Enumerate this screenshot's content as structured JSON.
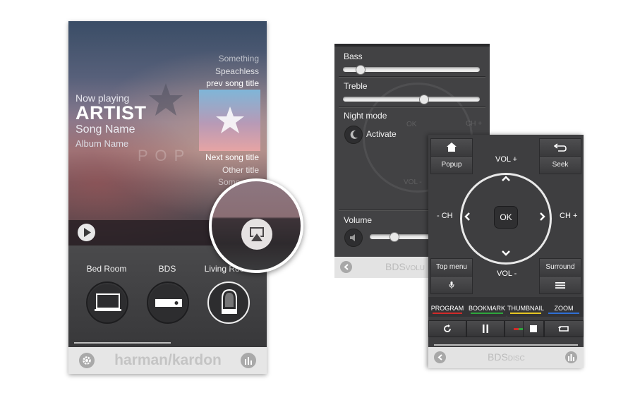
{
  "phone1": {
    "now_playing": "Now playing",
    "artist": "ARTIST",
    "song": "Song Name",
    "album": "Album Name",
    "watermark": "P O P",
    "prev_songs": [
      "Something",
      "Speachless",
      "prev song title"
    ],
    "next_songs": [
      "Next song title",
      "Other title",
      "Some"
    ],
    "rooms": [
      "Bed Room",
      "BDS",
      "Living Room"
    ],
    "brand": "harman/kardon"
  },
  "phone2": {
    "bass_label": "Bass",
    "bass_level": 0.1,
    "treble_label": "Treble",
    "treble_level": 0.6,
    "night_mode_label": "Night mode",
    "activate_label": "Activate",
    "volume_label": "Volume",
    "volume_level": 0.2,
    "footer_title": "BDS",
    "footer_sub": "VOLU",
    "ghost": [
      "OK",
      "CH +",
      "VOL -"
    ]
  },
  "phone3": {
    "popup_label": "Popup",
    "seek_label": "Seek",
    "vol_up": "VOL +",
    "vol_down": "VOL -",
    "ch_down": "- CH",
    "ch_up": "CH +",
    "ok": "OK",
    "top_menu": "Top menu",
    "surround": "Surround",
    "colors": [
      {
        "label": "PROGRAM",
        "color": "#d22a2a"
      },
      {
        "label": "BOOKMARK",
        "color": "#2ea63d"
      },
      {
        "label": "THUMBNAIL",
        "color": "#e6c622"
      },
      {
        "label": "ZOOM",
        "color": "#2f6fd6"
      }
    ],
    "footer_title": "BDS",
    "footer_sub": "DISC"
  },
  "colors": {
    "accent_blue": "#2f6fd6",
    "panel": "#3e3e40"
  }
}
